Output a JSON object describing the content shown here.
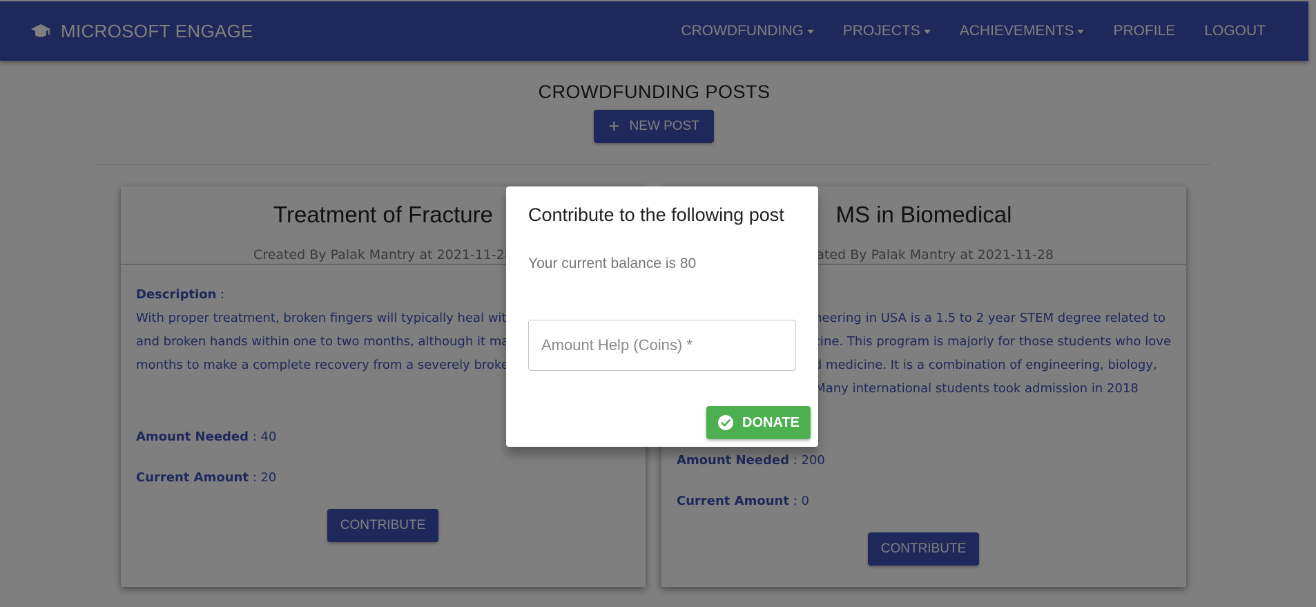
{
  "appbar": {
    "brand_icon": "graduation-cap-icon",
    "title": "MICROSOFT ENGAGE",
    "nav": [
      {
        "label": "CROWDFUNDING",
        "dropdown": true
      },
      {
        "label": "PROJECTS",
        "dropdown": true
      },
      {
        "label": "ACHIEVEMENTS",
        "dropdown": true
      },
      {
        "label": "PROFILE",
        "dropdown": false
      },
      {
        "label": "LOGOUT",
        "dropdown": false
      }
    ]
  },
  "main": {
    "title": "CROWDFUNDING POSTS",
    "new_post_icon": "plus-icon",
    "new_post_label": "NEW POST"
  },
  "labels": {
    "description": "Description",
    "amount_needed": "Amount Needed",
    "current_amount": "Current Amount",
    "separator": " : "
  },
  "posts": [
    {
      "title": "Treatment of Fracture",
      "meta": "Created By Palak Mantry at 2021-11-28",
      "description": "With proper treatment, broken fingers will typically heal within a month or so, and broken hands within one to two months, although it may take several months to make a complete recovery from a severely broken hand.",
      "amount_needed": "40",
      "current_amount": "20",
      "button": "CONTRIBUTE"
    },
    {
      "title": "MS in Biomedical",
      "meta": "Created By Palak Mantry at 2021-11-28",
      "description": "MS in Biomedical Engineering in USA is a 1.5 to 2 year STEM degree related to engineering and medicine. This program is majorly for those students who love the field of science and medicine. It is a combination of engineering, biology, and applied sciences. Many international students took admission in 2018",
      "amount_needed": "200",
      "current_amount": "0",
      "button": "CONTRIBUTE"
    }
  ],
  "dialog": {
    "title": "Contribute to the following post",
    "balance_text": "Your current balance is 80",
    "amount_value": "",
    "amount_placeholder": "Amount Help (Coins) *",
    "donate_icon": "check-circle-icon",
    "donate_label": "DONATE"
  },
  "colors": {
    "primary": "#3f51b5",
    "success": "#4caf50",
    "backdrop": "rgba(0,0,0,0.5)"
  }
}
